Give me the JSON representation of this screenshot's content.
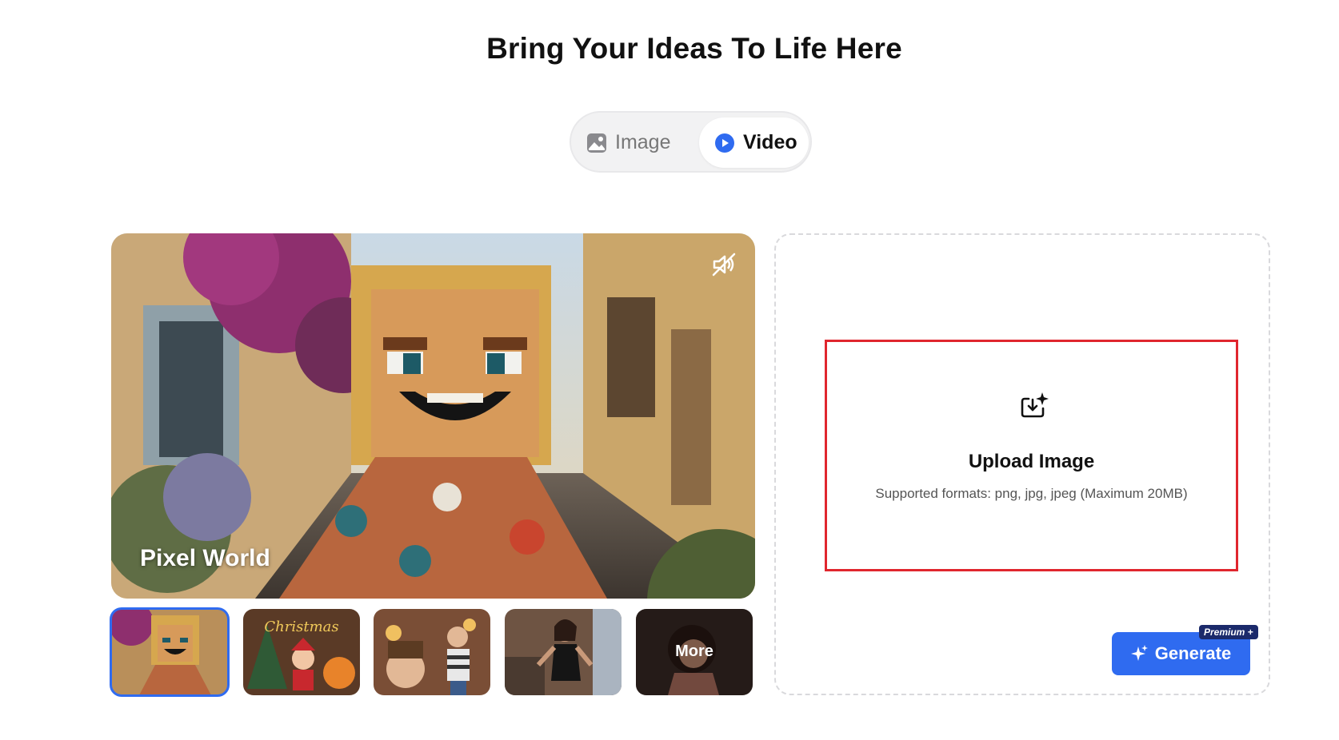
{
  "page": {
    "title": "Bring Your Ideas To Life Here"
  },
  "mode_toggle": {
    "tabs": [
      {
        "label": "Image",
        "active": false
      },
      {
        "label": "Video",
        "active": true
      }
    ]
  },
  "preview": {
    "caption": "Pixel World",
    "muted": true
  },
  "thumbnails": [
    {
      "name": "pixel-world",
      "active": true
    },
    {
      "name": "christmas",
      "active": false
    },
    {
      "name": "party",
      "active": false
    },
    {
      "name": "dance",
      "active": false
    },
    {
      "name": "more",
      "label": "More",
      "active": false
    }
  ],
  "upload": {
    "title": "Upload Image",
    "subtitle": "Supported formats: png, jpg, jpeg (Maximum 20MB)"
  },
  "generate": {
    "label": "Generate",
    "badge": "Premium +"
  },
  "colors": {
    "accent": "#2f6bf0",
    "highlight_border": "#e0262e",
    "badge": "#1b2a6b"
  }
}
